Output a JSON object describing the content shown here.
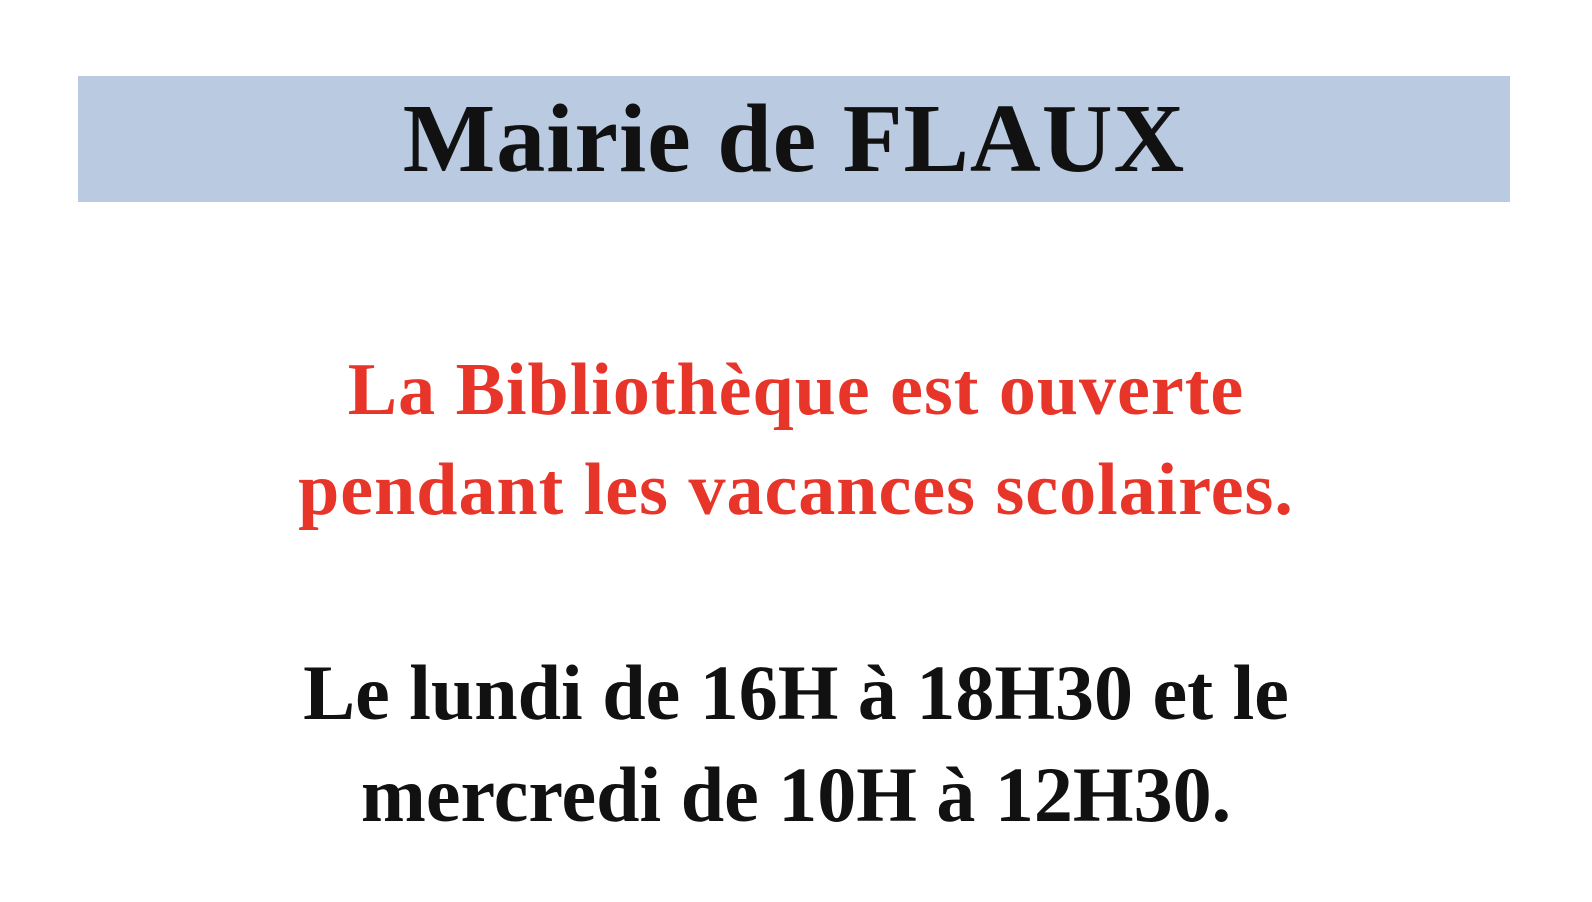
{
  "header": {
    "title": "Mairie de FLAUX",
    "background_color": "#b9cae1"
  },
  "announcement": {
    "lines": [
      "La Bibliothèque est ouverte",
      "pendant les vacances scolaires."
    ],
    "color": "#e8352a"
  },
  "schedule": {
    "lines": [
      "Le lundi de 16H à 18H30 et le",
      "mercredi de 10H à 12H30."
    ]
  }
}
